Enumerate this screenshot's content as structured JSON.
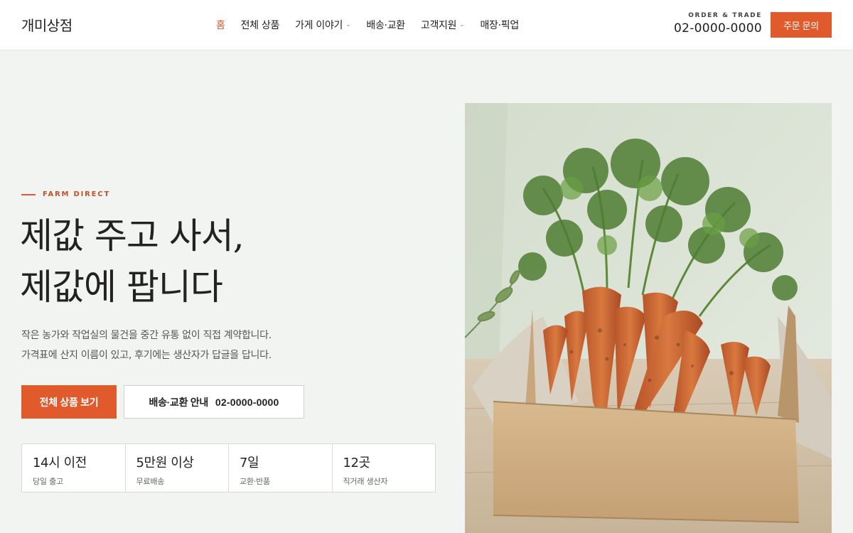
{
  "header": {
    "logo": "개미상점",
    "nav": [
      {
        "label": "홈",
        "active": true,
        "dropdown": false
      },
      {
        "label": "전체 상품",
        "active": false,
        "dropdown": false
      },
      {
        "label": "가게 이야기",
        "active": false,
        "dropdown": true
      },
      {
        "label": "배송·교환",
        "active": false,
        "dropdown": false
      },
      {
        "label": "고객지원",
        "active": false,
        "dropdown": true
      },
      {
        "label": "매장·픽업",
        "active": false,
        "dropdown": false
      }
    ],
    "contact_label": "ORDER & TRADE",
    "contact_phone": "02-0000-0000",
    "order_button": "주문 문의"
  },
  "hero": {
    "eyebrow": "FARM DIRECT",
    "headline_line1": "제값 주고 사서,",
    "headline_line2": "제값에 팝니다",
    "desc_line1": "작은 농가와 작업실의 물건을 중간 유통 없이 직접 계약합니다.",
    "desc_line2": "가격표에 산지 이름이 있고, 후기에는 생산자가 답글을 답니다.",
    "cta_primary": "전체 상품 보기",
    "cta_secondary_label": "배송·교환 안내",
    "cta_secondary_phone": "02-0000-0000",
    "stats": [
      {
        "value": "14시 이전",
        "label": "당일 출고"
      },
      {
        "value": "5만원 이상",
        "label": "무료배송"
      },
      {
        "value": "7일",
        "label": "교환·반품"
      },
      {
        "value": "12곳",
        "label": "직거래 생산자"
      }
    ],
    "image": "carrots-in-cardboard-box-photo"
  },
  "colors": {
    "accent": "#e05a2b",
    "background": "#f2f4f1",
    "text": "#222222"
  }
}
